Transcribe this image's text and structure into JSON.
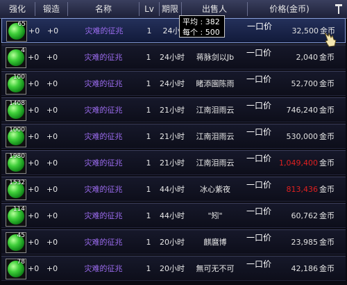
{
  "header": {
    "enhance": "强化",
    "forge": "锻造",
    "name": "名称",
    "level": "Lv",
    "period": "期限",
    "seller": "出售人",
    "price": "价格(金币)"
  },
  "rows": [
    {
      "count": "65",
      "enhance": "+0",
      "forge": "+0",
      "name": "灾难的征兆",
      "level": "1",
      "period": "24小",
      "seller": "子",
      "sale_type": "一口价",
      "price": "32,500",
      "currency": "金币",
      "price_color": "normal"
    },
    {
      "count": "4",
      "enhance": "+0",
      "forge": "+0",
      "name": "灾难的征兆",
      "level": "1",
      "period": "24小时",
      "seller": "蒋脉剑以Jb",
      "sale_type": "一口价",
      "price": "2,040",
      "currency": "金币",
      "price_color": "normal"
    },
    {
      "count": "100",
      "enhance": "+0",
      "forge": "+0",
      "name": "灾难的征兆",
      "level": "1",
      "period": "24小时",
      "seller": "睹添園陈雨",
      "sale_type": "一口价",
      "price": "52,700",
      "currency": "金币",
      "price_color": "normal"
    },
    {
      "count": "1408",
      "enhance": "+0",
      "forge": "+0",
      "name": "灾难的征兆",
      "level": "1",
      "period": "21小时",
      "seller": "江南泪雨云",
      "sale_type": "一口价",
      "price": "746,240",
      "currency": "金币",
      "price_color": "normal"
    },
    {
      "count": "1000",
      "enhance": "+0",
      "forge": "+0",
      "name": "灾难的征兆",
      "level": "1",
      "period": "21小时",
      "seller": "江南泪雨云",
      "sale_type": "一口价",
      "price": "530,000",
      "currency": "金币",
      "price_color": "normal"
    },
    {
      "count": "1980",
      "enhance": "+0",
      "forge": "+0",
      "name": "灾难的征兆",
      "level": "1",
      "period": "21小时",
      "seller": "江南泪雨云",
      "sale_type": "一口价",
      "price": "1,049,400",
      "currency": "金币",
      "price_color": "red"
    },
    {
      "count": "1532",
      "enhance": "+0",
      "forge": "+0",
      "name": "灾难的征兆",
      "level": "1",
      "period": "44小时",
      "seller": "冰心紫夜",
      "sale_type": "一口价",
      "price": "813,436",
      "currency": "金币",
      "price_color": "red"
    },
    {
      "count": "114",
      "enhance": "+0",
      "forge": "+0",
      "name": "灾难的征兆",
      "level": "1",
      "period": "44小时",
      "seller": "\"矧\"",
      "sale_type": "一口价",
      "price": "60,762",
      "currency": "金币",
      "price_color": "normal"
    },
    {
      "count": "45",
      "enhance": "+0",
      "forge": "+0",
      "name": "灾难的征兆",
      "level": "1",
      "period": "20小时",
      "seller": "麒麿博",
      "sale_type": "一口价",
      "price": "23,985",
      "currency": "金币",
      "price_color": "normal"
    },
    {
      "count": "78",
      "enhance": "+0",
      "forge": "+0",
      "name": "灾难的征兆",
      "level": "1",
      "period": "20小时",
      "seller": "無可无不可",
      "sale_type": "一口价",
      "price": "42,186",
      "currency": "金币",
      "price_color": "normal"
    }
  ],
  "tooltip": {
    "average_label": "平均 : 382",
    "each_label": "每个 : 500"
  },
  "icons": {
    "item": "green-orb-icon",
    "sort": "sort-pin-icon",
    "cursor": "hand-pointer-icon"
  },
  "colors": {
    "item_name": "#9c6cf0",
    "price_red": "#e02020",
    "header_bg": "#2a2e4c"
  }
}
